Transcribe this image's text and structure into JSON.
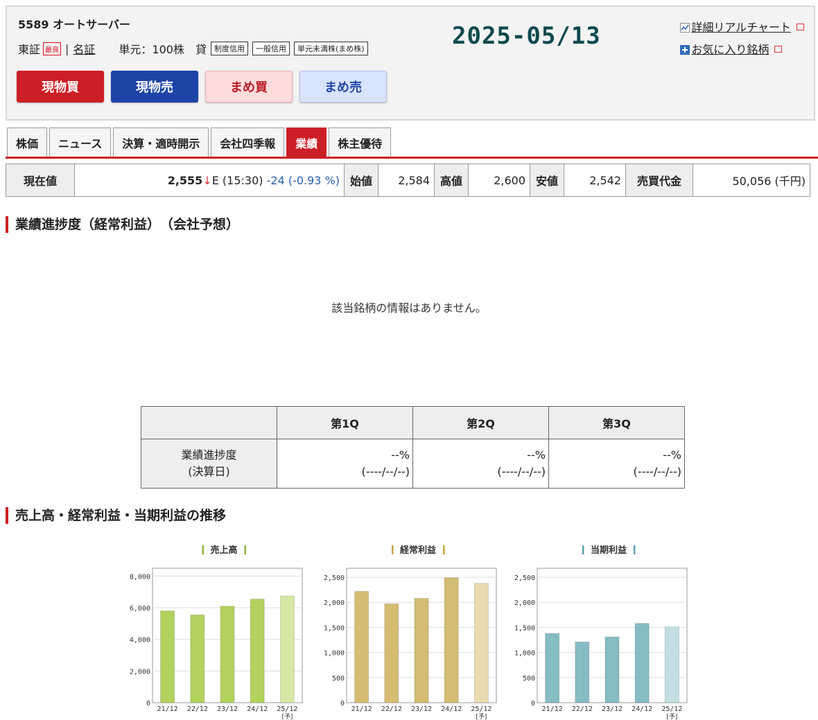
{
  "stock": {
    "code_name": "5589 オートサーバー",
    "market": "東証",
    "badge": "最良",
    "market2": "名証",
    "unit": "単元：100株",
    "lend": "貸",
    "tags": [
      "制度信用",
      "一般信用",
      "単元未満株(まめ株)"
    ]
  },
  "date": "2025-05/13",
  "links": {
    "chart": "詳細リアルチャート",
    "fav": "お気に入り銘柄"
  },
  "buttons": [
    "現物買",
    "現物売",
    "まめ買",
    "まめ売"
  ],
  "tabs": [
    "株価",
    "ニュース",
    "決算・適時開示",
    "会社四季報",
    "業績",
    "株主優待"
  ],
  "active_tab": "業績",
  "price": {
    "cur_label": "現在値",
    "cur_value": "2,555",
    "arrow": "↓",
    "flag": "E",
    "time": "(15:30)",
    "change": "-24 (-0.93 %)",
    "open_label": "始値",
    "open": "2,584",
    "high_label": "高値",
    "high": "2,600",
    "low_label": "安値",
    "low": "2,542",
    "turnover_label": "売買代金",
    "turnover": "50,056 (千円)"
  },
  "progress": {
    "title": "業績進捗度（経常利益）　（会社予想）",
    "no_info": "該当銘柄の情報はありません。",
    "quarters": [
      "第1Q",
      "第2Q",
      "第3Q"
    ],
    "row_label": [
      "業績進捗度",
      "(決算日)"
    ],
    "values": [
      "--%",
      "--%",
      "--%"
    ],
    "dates": [
      "(----/--/--)",
      "(----/--/--)",
      "(----/--/--)"
    ]
  },
  "trend_title": "売上高・経常利益・当期利益の推移",
  "chart_data": [
    {
      "type": "bar",
      "title": "売上高",
      "categories": [
        "21/12",
        "22/12",
        "23/12",
        "24/12",
        "25/12"
      ],
      "forecast_note": "[予]",
      "values": [
        5800,
        5550,
        6100,
        6550,
        6750
      ],
      "ylim": [
        0,
        8500
      ],
      "ytick_labels": [
        "8,000",
        "6,000",
        "4,000",
        "2,000",
        "0"
      ],
      "yticks": [
        8000,
        6000,
        4000,
        2000,
        0
      ],
      "color": "#b2d25e",
      "forecast_color": "#d6e8a6",
      "title_color": "#8fb339"
    },
    {
      "type": "bar",
      "title": "経常利益",
      "categories": [
        "21/12",
        "22/12",
        "23/12",
        "24/12",
        "25/12"
      ],
      "forecast_note": "[予]",
      "values": [
        2220,
        1970,
        2080,
        2490,
        2380
      ],
      "ylim": [
        0,
        2680
      ],
      "ytick_labels": [
        "2,500",
        "2,000",
        "1,500",
        "1,000",
        "500",
        "0"
      ],
      "yticks": [
        2500,
        2000,
        1500,
        1000,
        500,
        0
      ],
      "color": "#d4bd72",
      "forecast_color": "#e9dcb0",
      "title_color": "#c9a63a"
    },
    {
      "type": "bar",
      "title": "当期利益",
      "categories": [
        "21/12",
        "22/12",
        "23/12",
        "24/12",
        "25/12"
      ],
      "forecast_note": "[予]",
      "values": [
        1380,
        1210,
        1310,
        1580,
        1510
      ],
      "ylim": [
        0,
        2680
      ],
      "ytick_labels": [
        "2,500",
        "2,000",
        "1,500",
        "1,000",
        "500",
        "0"
      ],
      "yticks": [
        2500,
        2000,
        1500,
        1000,
        500,
        0
      ],
      "color": "#86bcc4",
      "forecast_color": "#c2dfe3",
      "title_color": "#5aa3ae"
    }
  ]
}
